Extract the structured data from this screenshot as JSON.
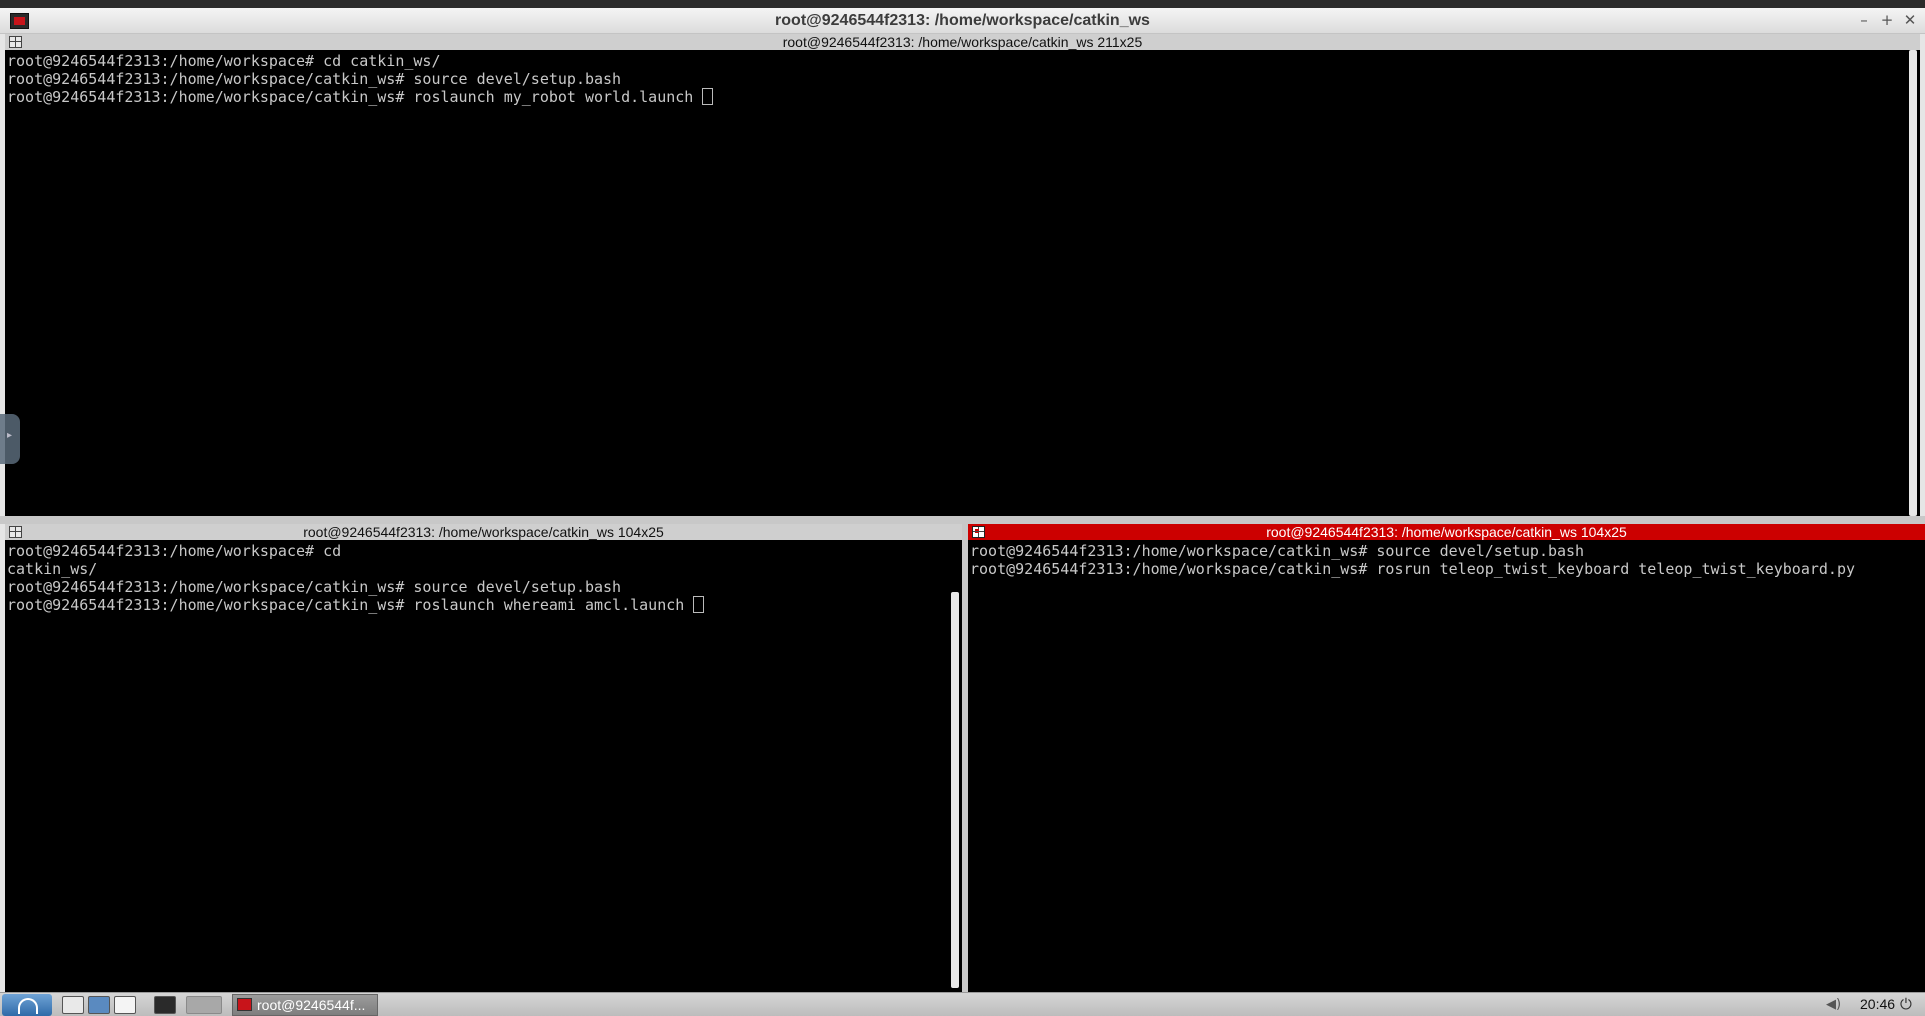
{
  "window": {
    "title": "root@9246544f2313: /home/workspace/catkin_ws",
    "buttons": {
      "minimize": "–",
      "maximize": "+",
      "close": "✕"
    }
  },
  "panes": {
    "top": {
      "title": "root@9246544f2313: /home/workspace/catkin_ws 211x25",
      "lines": [
        "root@9246544f2313:/home/workspace# cd catkin_ws/",
        "root@9246544f2313:/home/workspace/catkin_ws# source devel/setup.bash",
        "root@9246544f2313:/home/workspace/catkin_ws# roslaunch my_robot world.launch "
      ]
    },
    "bottom_left": {
      "title": "root@9246544f2313: /home/workspace/catkin_ws 104x25",
      "lines": [
        "root@9246544f2313:/home/workspace# cd",
        "catkin_ws/",
        "root@9246544f2313:/home/workspace/catkin_ws# source devel/setup.bash",
        "root@9246544f2313:/home/workspace/catkin_ws# roslaunch whereami amcl.launch "
      ]
    },
    "bottom_right": {
      "title": "root@9246544f2313: /home/workspace/catkin_ws 104x25",
      "lines": [
        "root@9246544f2313:/home/workspace/catkin_ws# source devel/setup.bash",
        "root@9246544f2313:/home/workspace/catkin_ws# rosrun teleop_twist_keyboard teleop_twist_keyboard.py"
      ]
    }
  },
  "taskbar": {
    "task_label": "root@9246544f...",
    "clock": "20:46"
  },
  "colors": {
    "active_pane": "#cc0000",
    "terminal_bg": "#000000",
    "terminal_fg": "#c8c8c8"
  }
}
